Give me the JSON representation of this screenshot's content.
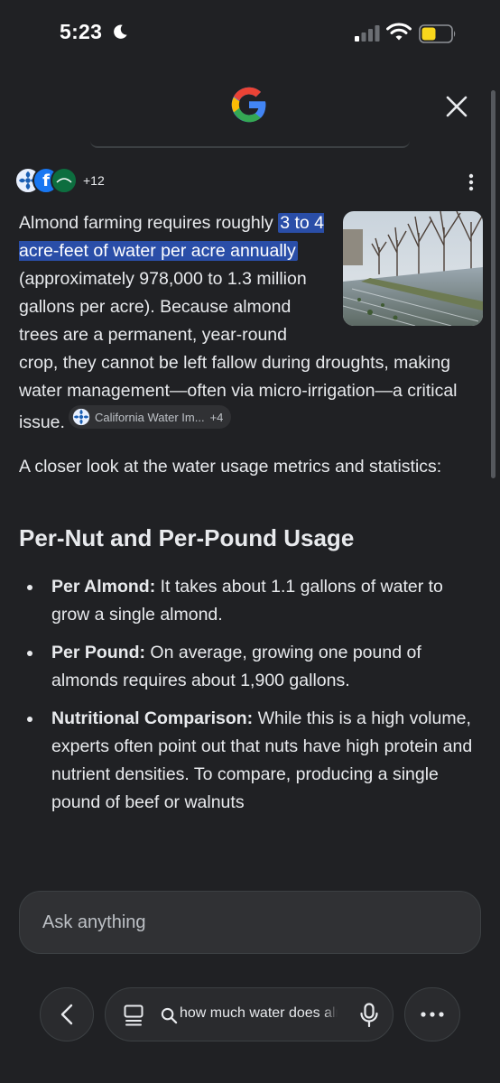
{
  "status_bar": {
    "time": "5:23",
    "icons": [
      "moon-icon",
      "cellular-signal-icon",
      "wifi-icon",
      "battery-icon"
    ],
    "battery_color": "#f9d71c"
  },
  "header": {
    "logo": "google-g-logo",
    "close_icon": "close-icon"
  },
  "sources": {
    "count_label": "+12"
  },
  "answer": {
    "intro_before": "Almond farming requires roughly ",
    "intro_highlight": "3 to 4 acre-feet of water per acre annually",
    "intro_after": " (approximately 978,000 to 1.3 million gallons per acre). Because almond trees are a permanent, year-round crop, they cannot be left fallow during droughts, making water management—often via micro-irrigation—a critical issue.",
    "citation": {
      "label": "California Water Im...",
      "more": "+4"
    },
    "closer_look": "A closer look at the water usage metrics and statistics:",
    "section_title": "Per-Nut and Per-Pound Usage",
    "bullets": [
      {
        "label": "Per Almond:",
        "text": " It takes about 1.1 gallons of water to grow a single almond."
      },
      {
        "label": "Per Pound:",
        "text": " On average, growing one pound of almonds requires about 1,900 gallons."
      },
      {
        "label": "Nutritional Comparison:",
        "text": " While this is a high volume, experts often point out that nuts have high protein and nutrient densities. To compare, producing a single pound of beef or walnuts"
      }
    ]
  },
  "ask_bar": {
    "placeholder": "Ask anything"
  },
  "bottom_nav": {
    "query": "how much water does almond farming use"
  },
  "colors": {
    "background": "#202124",
    "text": "#e8eaed",
    "highlight": "#2a4ea8",
    "surface": "#303134"
  }
}
